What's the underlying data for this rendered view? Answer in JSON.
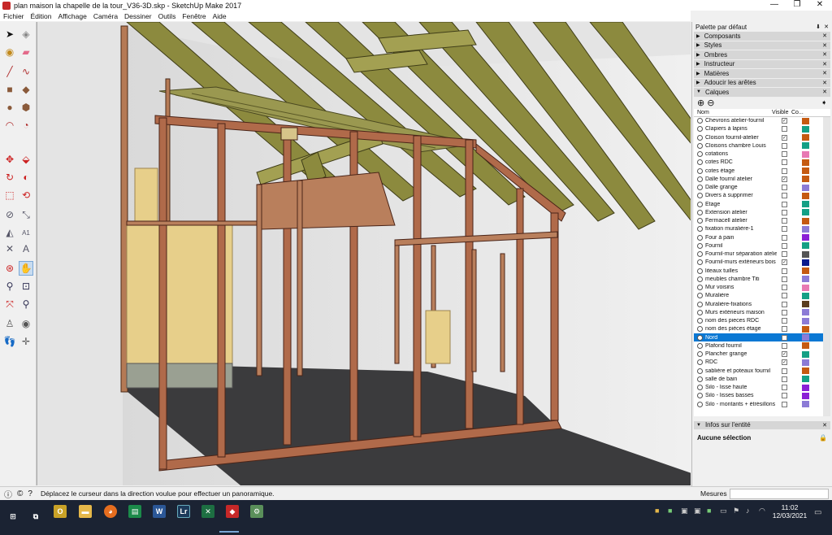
{
  "window": {
    "title": "plan maison la chapelle de la tour_V36-3D.skp - SketchUp Make 2017",
    "controls": [
      "—",
      "❐",
      "✕"
    ]
  },
  "menu": [
    "Fichier",
    "Édition",
    "Affichage",
    "Caméra",
    "Dessiner",
    "Outils",
    "Fenêtre",
    "Aide"
  ],
  "toolbar": {
    "tools": [
      "select",
      "make-component",
      "paint-bucket",
      "eraser",
      "line",
      "freehand",
      "rectangle",
      "rotated-rectangle",
      "circle",
      "polygon",
      "arc",
      "pie",
      "move",
      "push-pull",
      "rotate",
      "follow-me",
      "scale",
      "offset",
      "tape-measure",
      "dimension",
      "protractor",
      "text",
      "axes",
      "3d-text",
      "orbit",
      "pan",
      "zoom",
      "zoom-window",
      "zoom-extents",
      "previous",
      "position-camera",
      "look-around",
      "walk",
      "section-plane"
    ],
    "selected": "pan"
  },
  "panel": {
    "title": "Palette par défaut",
    "trays": [
      {
        "label": "Composants"
      },
      {
        "label": "Styles"
      },
      {
        "label": "Ombres"
      },
      {
        "label": "Instructeur"
      },
      {
        "label": "Matières"
      },
      {
        "label": "Adoucir les arêtes"
      }
    ],
    "layers_tray": {
      "label": "Calques",
      "columns": {
        "name": "Nom",
        "visible": "Visible",
        "color": "Co..."
      },
      "rows": [
        {
          "name": "Chevrons atelier-fournil",
          "visible": true,
          "color": "#c55a11"
        },
        {
          "name": "Clapiers à lapins",
          "visible": false,
          "color": "#14a085"
        },
        {
          "name": "Cloison fournil-atelier",
          "visible": true,
          "color": "#c55a11"
        },
        {
          "name": "Cloisons chambre Louis",
          "visible": false,
          "color": "#14a085"
        },
        {
          "name": "cotations",
          "visible": false,
          "color": "#e879b3"
        },
        {
          "name": "cotes RDC",
          "visible": false,
          "color": "#c55a11"
        },
        {
          "name": "cotes étage",
          "visible": false,
          "color": "#c55a11"
        },
        {
          "name": "Dalle fournil atelier",
          "visible": true,
          "color": "#c55a11"
        },
        {
          "name": "Dalle grange",
          "visible": false,
          "color": "#8c7bd6"
        },
        {
          "name": "Divers à supprimer",
          "visible": false,
          "color": "#c55a11"
        },
        {
          "name": "Etage",
          "visible": false,
          "color": "#14a085"
        },
        {
          "name": "Extension atelier",
          "visible": false,
          "color": "#14a085"
        },
        {
          "name": "Fermacell atelier",
          "visible": false,
          "color": "#c55a11"
        },
        {
          "name": "fixation muralière-1",
          "visible": false,
          "color": "#8c7bd6"
        },
        {
          "name": "Four à pain",
          "visible": false,
          "color": "#8b1fd6"
        },
        {
          "name": "Fournil",
          "visible": false,
          "color": "#14a085"
        },
        {
          "name": "Fournil-mur séparation atelie",
          "visible": false,
          "color": "#555555"
        },
        {
          "name": "Fournil-murs extérieurs bois",
          "visible": true,
          "color": "#0b1a8c"
        },
        {
          "name": "liteaux tuilles",
          "visible": false,
          "color": "#c55a11"
        },
        {
          "name": "meubles chambre Titi",
          "visible": false,
          "color": "#8c7bd6"
        },
        {
          "name": "Mur voisins",
          "visible": false,
          "color": "#e879b3"
        },
        {
          "name": "Muralière",
          "visible": false,
          "color": "#14a085"
        },
        {
          "name": "Muralière-fixations",
          "visible": false,
          "color": "#5a3d1e"
        },
        {
          "name": "Murs extérieurs maison",
          "visible": false,
          "color": "#8c7bd6"
        },
        {
          "name": "nom des pieces RDC",
          "visible": false,
          "color": "#8c7bd6"
        },
        {
          "name": "nom des pièces étage",
          "visible": false,
          "color": "#c55a11"
        },
        {
          "name": "Nord",
          "visible": false,
          "color": "#8c7bd6",
          "selected": true
        },
        {
          "name": "Plafond fournil",
          "visible": false,
          "color": "#c55a11"
        },
        {
          "name": "Plancher grange",
          "visible": true,
          "color": "#14a085"
        },
        {
          "name": "RDC",
          "visible": true,
          "color": "#8c7bd6"
        },
        {
          "name": "sablière et poteaux fournil",
          "visible": false,
          "color": "#c55a11"
        },
        {
          "name": "salle de bain",
          "visible": false,
          "color": "#14a085"
        },
        {
          "name": "Silo - lisse haute",
          "visible": false,
          "color": "#8b1fd6"
        },
        {
          "name": "Silo - lisses basses",
          "visible": false,
          "color": "#8b1fd6"
        },
        {
          "name": "Silo - montants + étrésillons",
          "visible": false,
          "color": "#8c7bd6"
        }
      ]
    },
    "entity_tray": {
      "label": "Infos sur l'entité",
      "selection": "Aucune sélection"
    }
  },
  "status": {
    "message": "Déplacez le curseur dans la direction voulue pour effectuer un panoramique.",
    "measure_label": "Mesures",
    "measure_value": ""
  },
  "taskbar": {
    "time": "11:02",
    "date": "12/03/2021",
    "apps": [
      "Start",
      "Task View",
      "Outlook",
      "Explorer",
      "Firefox",
      "Sheets",
      "Word",
      "Lightroom",
      "Excel",
      "SketchUp",
      "Scripts"
    ]
  }
}
